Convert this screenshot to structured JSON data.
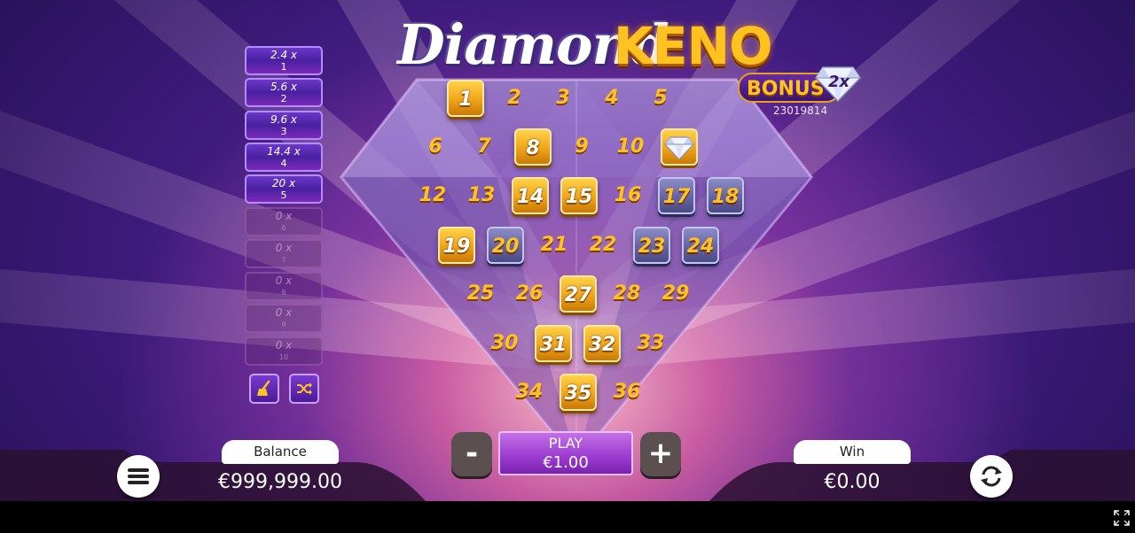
{
  "title": {
    "word1": "Diamond",
    "word2": "KENO"
  },
  "bonus": {
    "label": "BONUS",
    "multiplier": "2x",
    "round_id": "23019814"
  },
  "paytable": [
    {
      "mult": "2.4 x",
      "hits": "1",
      "active": true
    },
    {
      "mult": "5.6 x",
      "hits": "2",
      "active": true
    },
    {
      "mult": "9.6 x",
      "hits": "3",
      "active": true
    },
    {
      "mult": "14.4 x",
      "hits": "4",
      "active": true
    },
    {
      "mult": "20 x",
      "hits": "5",
      "active": true
    },
    {
      "mult": "0 x",
      "hits": "6",
      "active": false
    },
    {
      "mult": "0 x",
      "hits": "7",
      "active": false
    },
    {
      "mult": "0 x",
      "hits": "8",
      "active": false
    },
    {
      "mult": "0 x",
      "hits": "9",
      "active": false
    },
    {
      "mult": "0 x",
      "hits": "10",
      "active": false
    }
  ],
  "tools": {
    "clear_icon": "broom-icon",
    "random_icon": "shuffle-icon"
  },
  "grid": {
    "rows": [
      [
        {
          "n": "1",
          "s": "gold"
        },
        {
          "n": "2",
          "s": "plain"
        },
        {
          "n": "3",
          "s": "plain"
        },
        {
          "n": "4",
          "s": "plain"
        },
        {
          "n": "5",
          "s": "plain"
        }
      ],
      [
        {
          "n": "6",
          "s": "plain"
        },
        {
          "n": "7",
          "s": "plain"
        },
        {
          "n": "8",
          "s": "gold"
        },
        {
          "n": "9",
          "s": "plain"
        },
        {
          "n": "10",
          "s": "plain"
        },
        {
          "n": "",
          "s": "diamond"
        }
      ],
      [
        {
          "n": "12",
          "s": "plain"
        },
        {
          "n": "13",
          "s": "plain"
        },
        {
          "n": "14",
          "s": "gold"
        },
        {
          "n": "15",
          "s": "gold"
        },
        {
          "n": "16",
          "s": "plain"
        },
        {
          "n": "17",
          "s": "silver"
        },
        {
          "n": "18",
          "s": "silver"
        }
      ],
      [
        {
          "n": "19",
          "s": "gold"
        },
        {
          "n": "20",
          "s": "silver"
        },
        {
          "n": "21",
          "s": "plain"
        },
        {
          "n": "22",
          "s": "plain"
        },
        {
          "n": "23",
          "s": "silver"
        },
        {
          "n": "24",
          "s": "silver"
        }
      ],
      [
        {
          "n": "25",
          "s": "plain"
        },
        {
          "n": "26",
          "s": "plain"
        },
        {
          "n": "27",
          "s": "gold"
        },
        {
          "n": "28",
          "s": "plain"
        },
        {
          "n": "29",
          "s": "plain"
        }
      ],
      [
        {
          "n": "30",
          "s": "plain"
        },
        {
          "n": "31",
          "s": "gold"
        },
        {
          "n": "32",
          "s": "gold"
        },
        {
          "n": "33",
          "s": "plain"
        }
      ],
      [
        {
          "n": "34",
          "s": "plain"
        },
        {
          "n": "35",
          "s": "gold"
        },
        {
          "n": "36",
          "s": "plain"
        }
      ]
    ]
  },
  "balance": {
    "label": "Balance",
    "value": "€999,999.00"
  },
  "win": {
    "label": "Win",
    "value": "€0.00"
  },
  "bet": {
    "minus": "-",
    "plus": "+",
    "play_label": "PLAY",
    "amount": "€1.00"
  },
  "icons": {
    "menu": "menu-icon",
    "autoplay": "autoplay-icon",
    "fullscreen": "fullscreen-icon"
  }
}
